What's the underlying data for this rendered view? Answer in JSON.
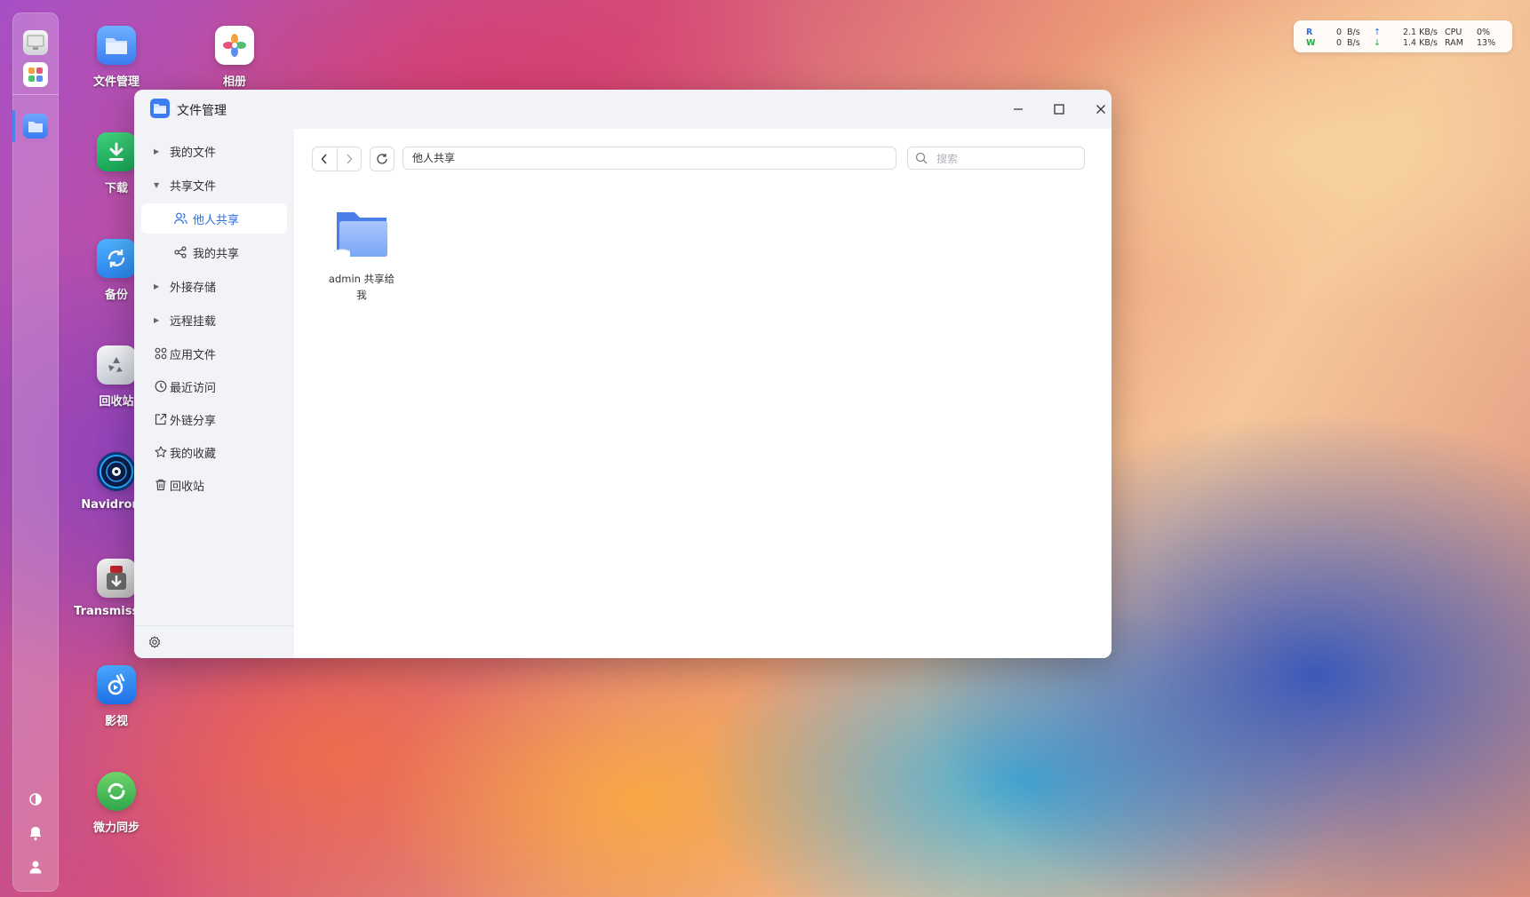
{
  "desktop": {
    "icons": [
      {
        "label": "文件管理"
      },
      {
        "label": "相册"
      },
      {
        "label": "下载"
      },
      {
        "label": "备份"
      },
      {
        "label": "回收站"
      },
      {
        "label": "Navidrome"
      },
      {
        "label": "Transmission"
      },
      {
        "label": "影视"
      },
      {
        "label": "微力同步"
      }
    ]
  },
  "monitor": {
    "read_label": "R",
    "read_value": "0",
    "read_unit": "B/s",
    "write_label": "W",
    "write_value": "0",
    "write_unit": "B/s",
    "upload_value": "2.1 KB/s",
    "download_value": "1.4 KB/s",
    "cpu_label": "CPU",
    "cpu_value": "0%",
    "ram_label": "RAM",
    "ram_value": "13%"
  },
  "window": {
    "title": "文件管理",
    "sidebar": {
      "items": [
        {
          "label": "我的文件"
        },
        {
          "label": "共享文件"
        },
        {
          "label": "他人共享"
        },
        {
          "label": "我的共享"
        },
        {
          "label": "外接存储"
        },
        {
          "label": "远程挂载"
        },
        {
          "label": "应用文件"
        },
        {
          "label": "最近访问"
        },
        {
          "label": "外链分享"
        },
        {
          "label": "我的收藏"
        },
        {
          "label": "回收站"
        }
      ]
    },
    "toolbar": {
      "path": "他人共享",
      "search_placeholder": "搜索"
    },
    "files": [
      {
        "name": "admin 共享给我"
      }
    ]
  },
  "colors": {
    "accent": "#2f6fe0",
    "folder": "#5b8ef0"
  }
}
